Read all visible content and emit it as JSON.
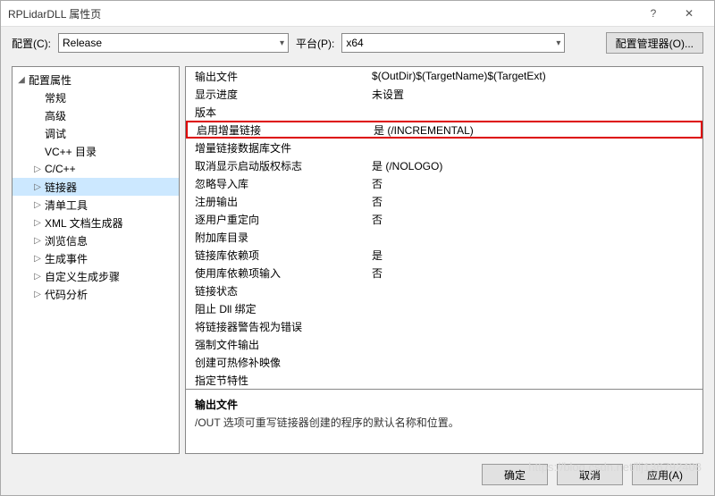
{
  "titlebar": {
    "title": "RPLidarDLL 属性页",
    "help": "?",
    "close": "✕"
  },
  "config": {
    "config_label": "配置(C):",
    "config_value": "Release",
    "platform_label": "平台(P):",
    "platform_value": "x64",
    "config_mgr_label": "配置管理器(O)..."
  },
  "tree": {
    "items": [
      {
        "label": "配置属性",
        "depth": 1,
        "expander": "◢"
      },
      {
        "label": "常规",
        "depth": 2,
        "expander": ""
      },
      {
        "label": "高级",
        "depth": 2,
        "expander": ""
      },
      {
        "label": "调试",
        "depth": 2,
        "expander": ""
      },
      {
        "label": "VC++ 目录",
        "depth": 2,
        "expander": ""
      },
      {
        "label": "C/C++",
        "depth": 2,
        "expander": "▷"
      },
      {
        "label": "链接器",
        "depth": 2,
        "expander": "▷",
        "selected": true
      },
      {
        "label": "清单工具",
        "depth": 2,
        "expander": "▷"
      },
      {
        "label": "XML 文档生成器",
        "depth": 2,
        "expander": "▷"
      },
      {
        "label": "浏览信息",
        "depth": 2,
        "expander": "▷"
      },
      {
        "label": "生成事件",
        "depth": 2,
        "expander": "▷"
      },
      {
        "label": "自定义生成步骤",
        "depth": 2,
        "expander": "▷"
      },
      {
        "label": "代码分析",
        "depth": 2,
        "expander": "▷"
      }
    ]
  },
  "props": {
    "rows": [
      {
        "label": "输出文件",
        "value": "$(OutDir)$(TargetName)$(TargetExt)"
      },
      {
        "label": "显示进度",
        "value": "未设置"
      },
      {
        "label": "版本",
        "value": ""
      },
      {
        "label": "启用增量链接",
        "value": "是 (/INCREMENTAL)",
        "highlight": true
      },
      {
        "label": "增量链接数据库文件",
        "value": ""
      },
      {
        "label": "取消显示启动版权标志",
        "value": "是 (/NOLOGO)"
      },
      {
        "label": "忽略导入库",
        "value": "否"
      },
      {
        "label": "注册输出",
        "value": "否"
      },
      {
        "label": "逐用户重定向",
        "value": "否"
      },
      {
        "label": "附加库目录",
        "value": ""
      },
      {
        "label": "链接库依赖项",
        "value": "是"
      },
      {
        "label": "使用库依赖项输入",
        "value": "否"
      },
      {
        "label": "链接状态",
        "value": ""
      },
      {
        "label": "阻止 Dll 绑定",
        "value": ""
      },
      {
        "label": "将链接器警告视为错误",
        "value": ""
      },
      {
        "label": "强制文件输出",
        "value": ""
      },
      {
        "label": "创建可热修补映像",
        "value": ""
      },
      {
        "label": "指定节特性",
        "value": ""
      }
    ]
  },
  "desc": {
    "title": "输出文件",
    "text": "/OUT 选项可重写链接器创建的程序的默认名称和位置。"
  },
  "footer": {
    "ok": "确定",
    "cancel": "取消",
    "apply": "应用(A)"
  },
  "watermark": "https://blog.csdn.net/llj136792408"
}
